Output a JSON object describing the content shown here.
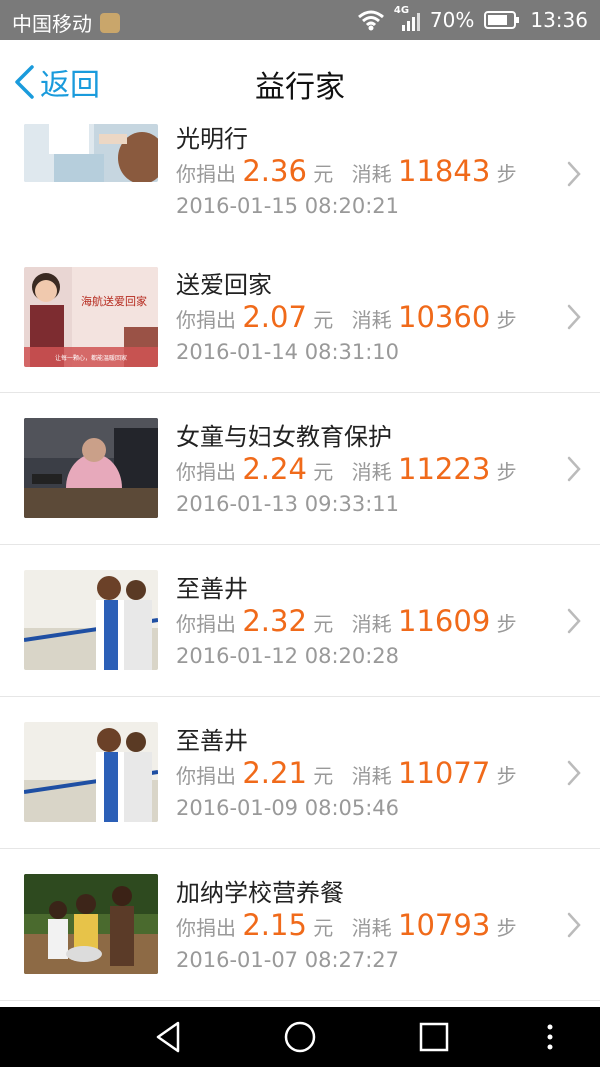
{
  "status_bar": {
    "carrier": "中国移动",
    "network": "4G",
    "battery": "70%",
    "time": "13:36"
  },
  "header": {
    "back_label": "返回",
    "title": "益行家"
  },
  "labels": {
    "donate_prefix": "你捐出",
    "currency": "元",
    "consume_prefix": "消耗",
    "steps_unit": "步"
  },
  "items": [
    {
      "title": "光明行",
      "amount": "2.36",
      "steps": "11843",
      "date": "2016-01-15 08:20:21"
    },
    {
      "title": "送爱回家",
      "amount": "2.07",
      "steps": "10360",
      "date": "2016-01-14 08:31:10"
    },
    {
      "title": "女童与妇女教育保护",
      "amount": "2.24",
      "steps": "11223",
      "date": "2016-01-13 09:33:11"
    },
    {
      "title": "至善井",
      "amount": "2.32",
      "steps": "11609",
      "date": "2016-01-12 08:20:28"
    },
    {
      "title": "至善井",
      "amount": "2.21",
      "steps": "11077",
      "date": "2016-01-09 08:05:46"
    },
    {
      "title": "加纳学校营养餐",
      "amount": "2.15",
      "steps": "10793",
      "date": "2016-01-07 08:27:27"
    }
  ],
  "thumb_texts": {
    "item2_banner": "海航送爱回家",
    "item2_sub": "让每一颗心，都能温暖回家"
  },
  "colors": {
    "accent": "#1a9bdc",
    "amount": "#f06a1a",
    "status_bar": "#7a7a7a"
  }
}
